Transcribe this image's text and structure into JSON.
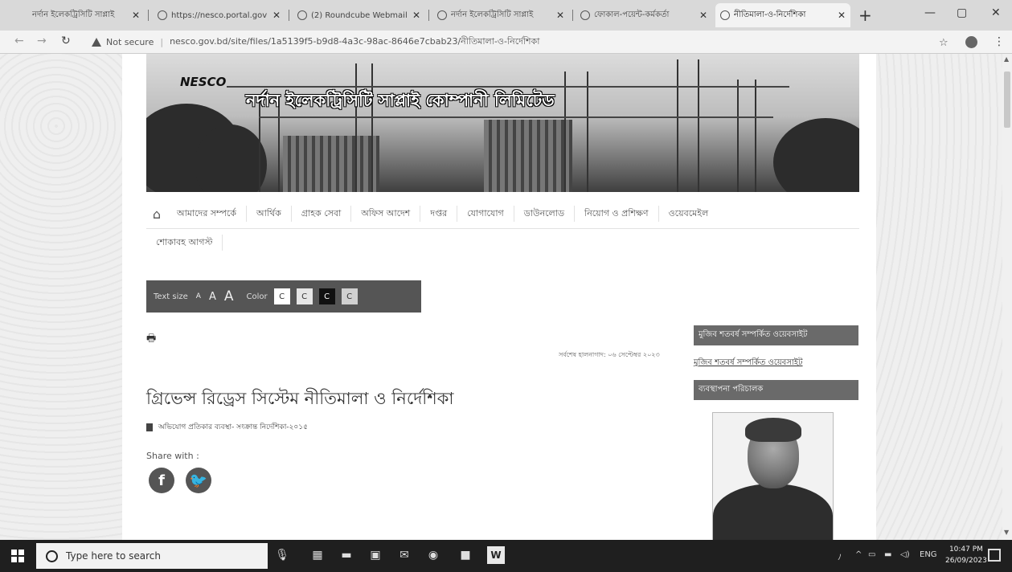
{
  "browser": {
    "tabs": [
      {
        "label": "নর্দান ইলেকট্রিসিটি সাপ্লাই",
        "active": false
      },
      {
        "label": "https://nesco.portal.gov",
        "active": false
      },
      {
        "label": "(2) Roundcube Webmail",
        "active": false
      },
      {
        "label": "নর্দান ইলেকট্রিসিটি সাপ্লাই",
        "active": false
      },
      {
        "label": "ফোকাল-পয়েন্ট-কর্মকর্তা",
        "active": false
      },
      {
        "label": "নীতিমালা-ও-নির্দেশিকা",
        "active": true
      }
    ],
    "security": "Not secure",
    "url": "nesco.gov.bd/site/files/1a5139f5-b9d8-4a3c-98ac-8646e7cbab23/নীতিমালা-ও-নির্দেশিকা"
  },
  "site": {
    "logo": "NESCO",
    "title": "নর্দান ইলেকট্রিসিটি সাপ্লাই কোম্পানী লিমিটেড"
  },
  "nav": {
    "items": [
      "আমাদের সম্পর্কে",
      "আর্থিক",
      "গ্রাহক সেবা",
      "অফিস আদেশ",
      "দপ্তর",
      "যোগাযোগ",
      "ডাউনলোড",
      "নিয়োগ ও প্রশিক্ষণ",
      "ওয়েবমেইল"
    ],
    "row2": [
      "শোকাবহ আগস্ট"
    ]
  },
  "accessibility": {
    "text_size_label": "Text size",
    "sizes": [
      "A",
      "A",
      "A"
    ],
    "color_label": "Color",
    "colors": [
      {
        "label": "C",
        "bg": "#ffffff",
        "fg": "#333333"
      },
      {
        "label": "C",
        "bg": "#e6e6e6",
        "fg": "#333333"
      },
      {
        "label": "C",
        "bg": "#111111",
        "fg": "#ffffff"
      },
      {
        "label": "C",
        "bg": "#d0d0d0",
        "fg": "#333333"
      }
    ]
  },
  "article": {
    "updated": "সর্বশেষ হালনাগাদ: ০৬ সেপ্টেম্বর ২০২৩",
    "title": "গ্রিভেন্স রিড্রেস সিস্টেম নীতিমালা ও নির্দেশিকা",
    "document_link": "অভিযোগ প্রতিকার ব্যবস্থা- সংক্রান্ত নির্দেশিকা-২০১৫",
    "share_label": "Share with :"
  },
  "sidebar": {
    "heading1": "মুজিব শতবর্ষ সম্পর্কিত ওয়েবসাইট",
    "link1": "মুজিব শতবর্ষ সম্পর্কিত ওয়েবসাইট",
    "heading2": "ব্যবস্থাপনা পরিচালক"
  },
  "taskbar": {
    "search_placeholder": "Type here to search",
    "time": "10:47 PM",
    "date": "26/09/2023"
  }
}
